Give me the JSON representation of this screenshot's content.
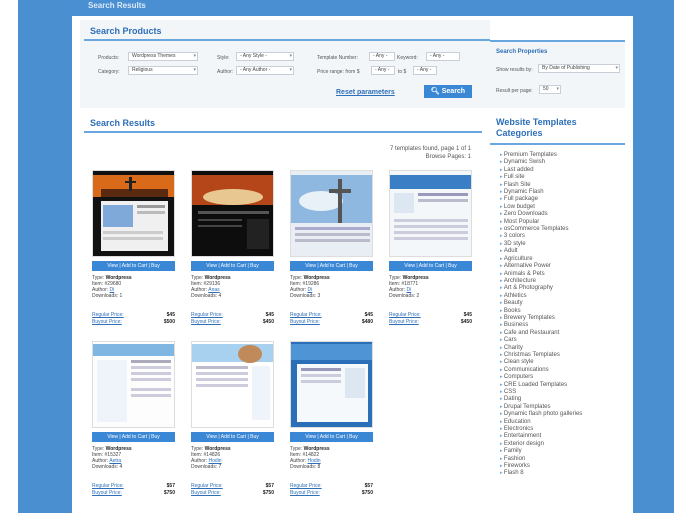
{
  "header": {
    "title": "Search Results"
  },
  "search": {
    "title": "Search Products",
    "products_label": "Products:",
    "products_value": "Wordpress Themes",
    "style_label": "Style:",
    "style_value": "- Any Style -",
    "template_number_label": "Template Number:",
    "template_number_value": "- Any -",
    "keyword_label": "Keyword:",
    "keyword_value": "- Any -",
    "category_label": "Category:",
    "category_value": "Religious",
    "author_label": "Author:",
    "author_value": "- Any Author -",
    "price_label": "Price range: from $",
    "price_from": "- Any -",
    "price_to_label": "to $",
    "price_to": "- Any -",
    "reset_label": "Reset parameters",
    "search_button": "Search"
  },
  "properties": {
    "title": "Search Properties",
    "sort_label": "Show results by:",
    "sort_value": "By Date of Publishing",
    "per_page_label": "Result per page:",
    "per_page_value": "50"
  },
  "results": {
    "title": "Search Results",
    "count": "7 templates found, page 1 of 1",
    "pages": "Browse Pages: 1",
    "bar_label": "View | Add to Cart | Buy",
    "type_label": "Type:",
    "item_label": "Item:",
    "author_label": "Author:",
    "downloads_label": "Downloads:",
    "regular_label": "Regular Price:",
    "buyout_label": "Buyout Price:",
    "items": [
      {
        "type": "Wordpress",
        "item": "#29680",
        "author": "Di",
        "downloads": "1",
        "regular": "$45",
        "buyout": "$500"
      },
      {
        "type": "Wordpress",
        "item": "#29136",
        "author": "Anas",
        "downloads": "4",
        "regular": "$45",
        "buyout": "$450"
      },
      {
        "type": "Wordpress",
        "item": "#19286",
        "author": "Di",
        "downloads": "3",
        "regular": "$45",
        "buyout": "$480"
      },
      {
        "type": "Wordpress",
        "item": "#18771",
        "author": "Di",
        "downloads": "2",
        "regular": "$45",
        "buyout": "$450"
      },
      {
        "type": "Wordpress",
        "item": "#15327",
        "author": "Aetra",
        "downloads": "4",
        "regular": "$57",
        "buyout": "$750"
      },
      {
        "type": "Wordpress",
        "item": "#14826",
        "author": "Hodin",
        "downloads": "7",
        "regular": "$57",
        "buyout": "$750"
      },
      {
        "type": "Wordpress",
        "item": "#14822",
        "author": "Hodin",
        "downloads": "8",
        "regular": "$57",
        "buyout": "$750"
      }
    ]
  },
  "categories": {
    "title": "Website Templates Categories",
    "items": [
      "Premium Templates",
      "Dynamic Swish",
      "Last added",
      "Full site",
      "Flash Site",
      "Dynamic Flash",
      "Full package",
      "Low budget",
      "Zero Downloads",
      "Most Popular",
      "osCommerce Templates",
      "3 colors",
      "3D style",
      "Adult",
      "Agriculture",
      "Alternative Power",
      "Animals & Pets",
      "Architecture",
      "Art & Photography",
      "Athletics",
      "Beauty",
      "Books",
      "Brewery Templates",
      "Business",
      "Cafe and Restaurant",
      "Cars",
      "Charity",
      "Christmas Templates",
      "Clean style",
      "Communications",
      "Computers",
      "CRE Loaded Templates",
      "CSS",
      "Dating",
      "Drupal Templates",
      "Dynamic flash photo galleries",
      "Education",
      "Electronics",
      "Entertainment",
      "Exterior design",
      "Family",
      "Fashion",
      "Fireworks",
      "Flash 8"
    ]
  },
  "colors": {
    "brand": "#4a90d0",
    "accent": "#2d6fb8",
    "button": "#3a87d6"
  }
}
